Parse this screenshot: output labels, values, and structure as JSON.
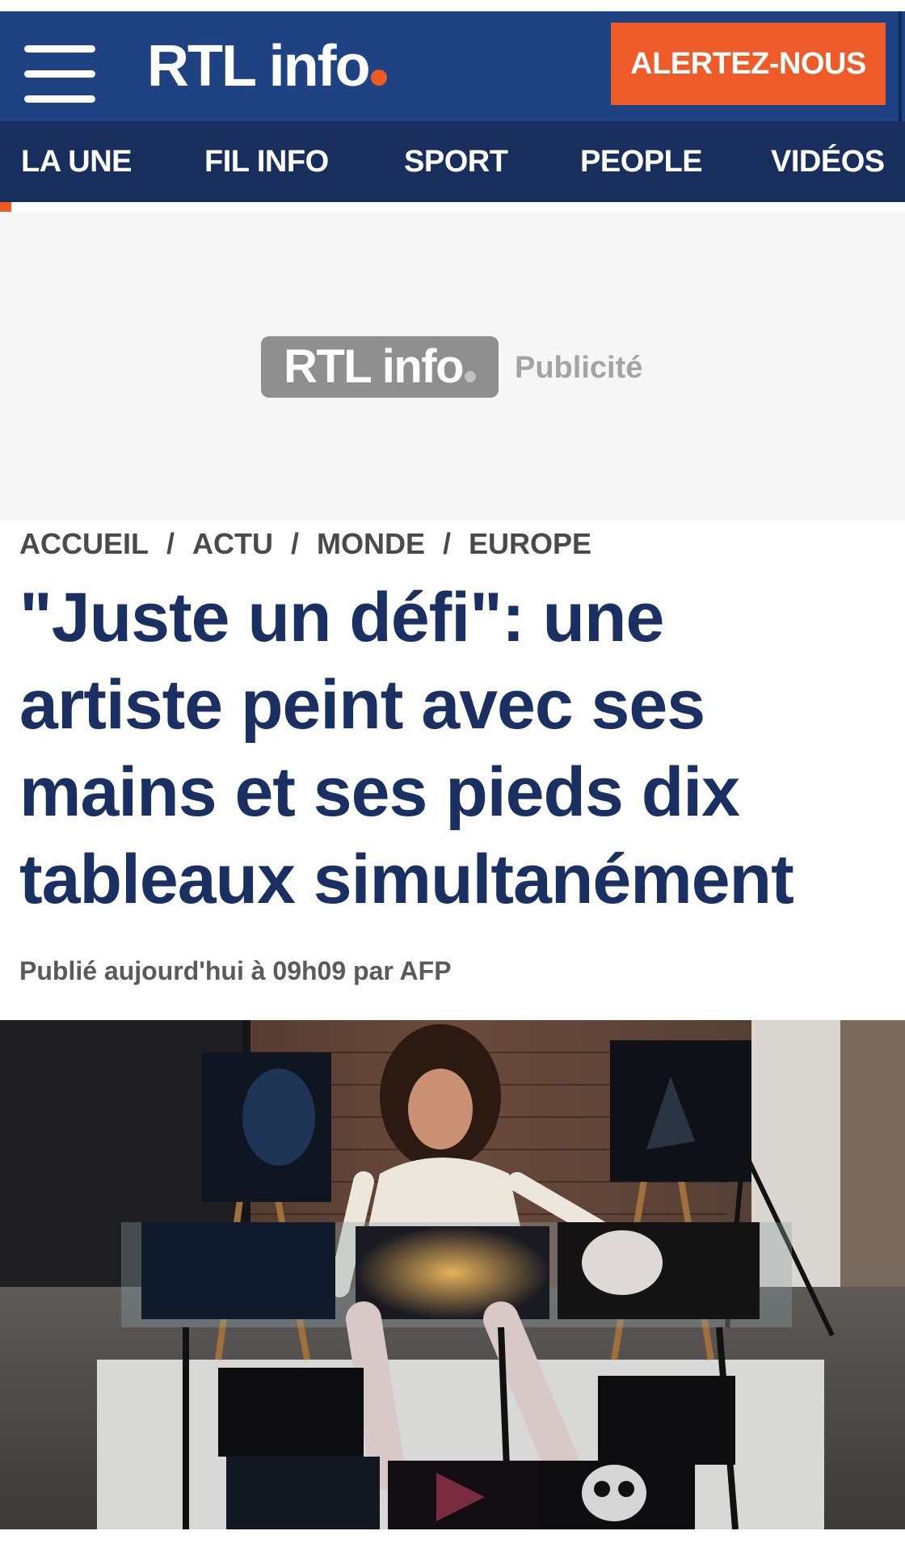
{
  "header": {
    "logo_text": "RTL info",
    "alert_button": "ALERTEZ-NOUS"
  },
  "nav": {
    "items": [
      {
        "label": "LA UNE"
      },
      {
        "label": "FIL INFO"
      },
      {
        "label": "SPORT"
      },
      {
        "label": "PEOPLE"
      },
      {
        "label": "VIDÉOS"
      }
    ]
  },
  "ad": {
    "logo_text": "RTL info",
    "label": "Publicité"
  },
  "breadcrumb": [
    "ACCUEIL",
    "ACTU",
    "MONDE",
    "EUROPE"
  ],
  "breadcrumb_separator": "/",
  "article": {
    "title": "\"Juste un défi\": une artiste peint avec ses mains et ses pieds dix tableaux simultanément",
    "meta": "Publié aujourd'hui à 09h09 par AFP"
  },
  "colors": {
    "header_blue": "#1f4282",
    "nav_blue": "#182f5e",
    "accent_orange": "#ee5a28",
    "title_navy": "#1a2f62"
  }
}
